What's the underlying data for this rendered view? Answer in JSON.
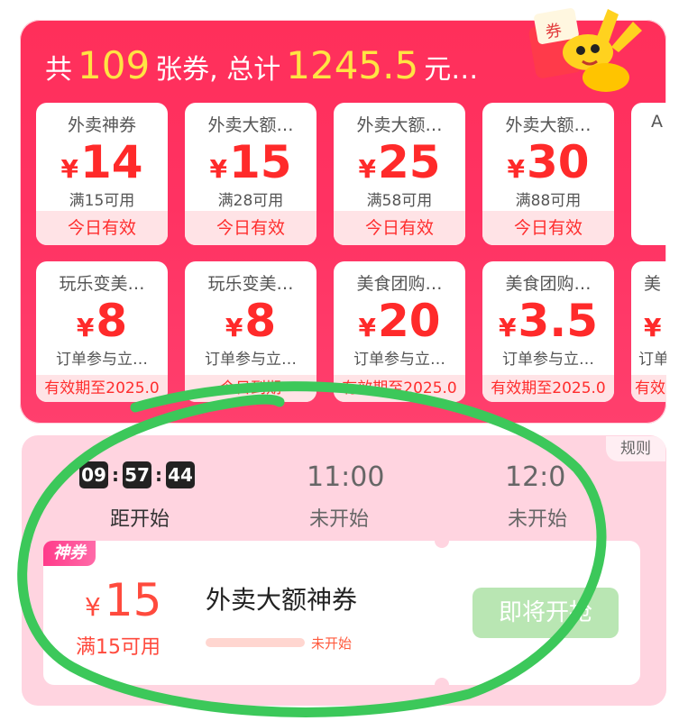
{
  "summary": {
    "prefix": "共",
    "count": "109",
    "middle": "张券, 总计",
    "total": "1245.5",
    "suffix": "元…"
  },
  "coupons_row1": [
    {
      "name": "外卖神券",
      "yen": "¥",
      "amount": "14",
      "cond": "满15可用",
      "footer": "今日有效"
    },
    {
      "name": "外卖大额…",
      "yen": "¥",
      "amount": "15",
      "cond": "满28可用",
      "footer": "今日有效"
    },
    {
      "name": "外卖大额…",
      "yen": "¥",
      "amount": "25",
      "cond": "满58可用",
      "footer": "今日有效"
    },
    {
      "name": "外卖大额…",
      "yen": "¥",
      "amount": "30",
      "cond": "满88可用",
      "footer": "今日有效"
    },
    {
      "name": "A",
      "yen": "",
      "amount": "",
      "cond": "",
      "footer": ""
    }
  ],
  "coupons_row2": [
    {
      "name": "玩乐变美…",
      "yen": "¥",
      "amount": "8",
      "cond": "订单参与立…",
      "footer": "有效期至2025.0"
    },
    {
      "name": "玩乐变美…",
      "yen": "¥",
      "amount": "8",
      "cond": "订单参与立…",
      "footer": "今日到期"
    },
    {
      "name": "美食团购…",
      "yen": "¥",
      "amount": "20",
      "cond": "订单参与立…",
      "footer": "有效期至2025.0"
    },
    {
      "name": "美食团购…",
      "yen": "¥",
      "amount": "3.5",
      "cond": "订单参与立…",
      "footer": "有效期至2025.0"
    },
    {
      "name": "美",
      "yen": "¥",
      "amount": "",
      "cond": "订单",
      "footer": "有效"
    }
  ],
  "rules": "规则",
  "countdown": {
    "h": "09",
    "m": "57",
    "s": "44",
    "label": "距开始"
  },
  "slots": [
    {
      "time": "11:00",
      "label": "未开始"
    },
    {
      "time": "12:0",
      "label": "未开始"
    }
  ],
  "deal": {
    "tag": "神券",
    "yen": "¥",
    "amount": "15",
    "cond": "满15可用",
    "title": "外卖大额神券",
    "progress": 0,
    "status": "未开始",
    "button": "即将开抢"
  },
  "colors": {
    "brand_red": "#ff2f5a",
    "highlight_yellow": "#ffe443",
    "price_red": "#ff2a2a",
    "button_disabled": "#b9e6b3",
    "annotation_green": "#3cc85a"
  },
  "icons": [
    "coupon-envelope-icon",
    "mascot-icon"
  ]
}
